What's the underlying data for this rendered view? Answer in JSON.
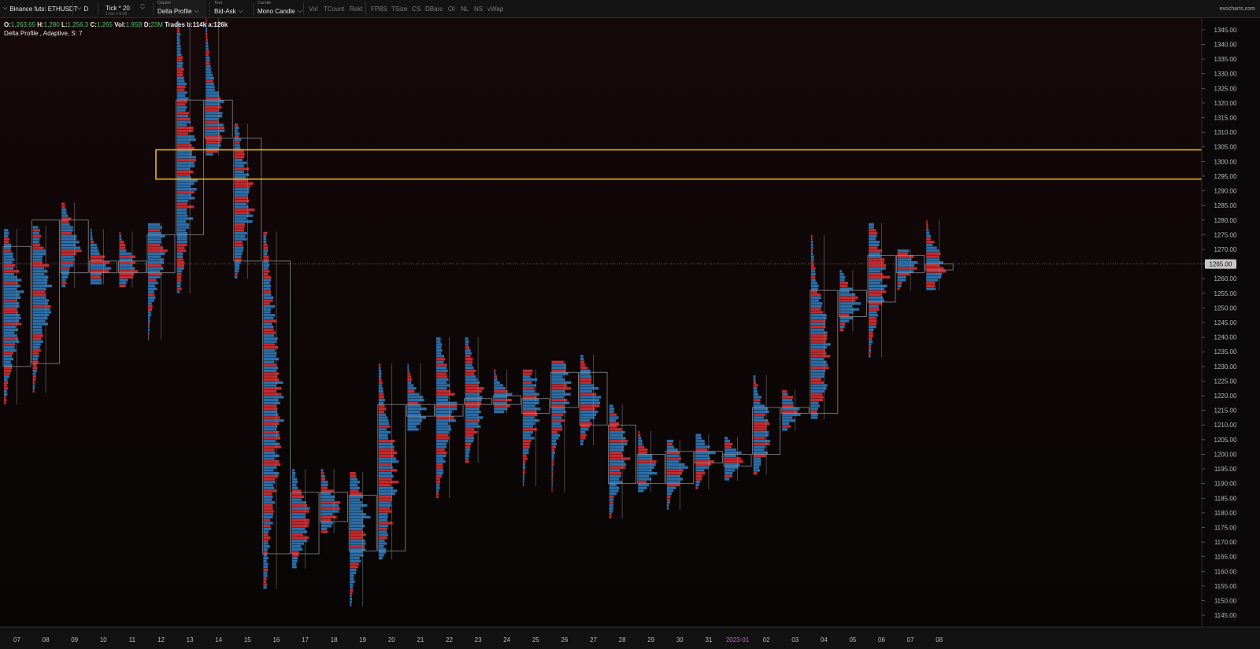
{
  "toolbar": {
    "symbol": "Binance futs: ETHUSDT",
    "timeframe": "D",
    "tick_label": "Tick * 20",
    "tick_sub": "1 tick = 0.05",
    "cluster_caption": "Cluster",
    "cluster_value": "Delta Profile",
    "text_caption": "Text",
    "text_value": "Bid-Ask",
    "candle_caption": "Candle",
    "candle_value": "Mono Candle",
    "toggles": [
      "Vol",
      "TCount",
      "Rekt",
      "FPBS",
      "TSize",
      "CS",
      "DBars",
      "OI",
      "NL",
      "NS",
      "vWap"
    ],
    "brand": "exocharts.com"
  },
  "info": {
    "o_label": "O:",
    "o": "1,263.65",
    "h_label": "H:",
    "h": "1,280",
    "l_label": "L:",
    "l": "1,256.3",
    "c_label": "C:",
    "c": "1,265",
    "vol_label": "Vol:",
    "vol": "1.95B",
    "d_label": "D:",
    "d": "23M",
    "trades_label": "Trades",
    "trades": "b:114k a:126k",
    "indicator": "Delta Profile , Adaptive, S: 7"
  },
  "colors": {
    "bid": "#c42a2e",
    "ask": "#2b6ea8",
    "highlight": "#e8b81c",
    "box": "#9aa0a6",
    "axis_text": "#b8b8b8",
    "year_label": "#c060c0"
  },
  "chart_data": {
    "type": "delta-profile",
    "ylim": [
      1141,
      1349
    ],
    "y_ticks": [
      1145,
      1150,
      1155,
      1160,
      1165,
      1170,
      1175,
      1180,
      1185,
      1190,
      1195,
      1200,
      1205,
      1210,
      1215,
      1220,
      1225,
      1230,
      1235,
      1240,
      1245,
      1250,
      1255,
      1260,
      1265,
      1270,
      1275,
      1280,
      1285,
      1290,
      1295,
      1300,
      1305,
      1310,
      1315,
      1320,
      1325,
      1330,
      1335,
      1340,
      1345
    ],
    "y_tick_labels": [
      "1145.00",
      "1150.00",
      "1155.00",
      "1160.00",
      "1165.00",
      "1170.00",
      "1175.00",
      "1180.00",
      "1185.00",
      "1190.00",
      "1195.00",
      "1200.00",
      "1205.00",
      "1210.00",
      "1215.00",
      "1220.00",
      "1225.00",
      "1230.00",
      "1235.00",
      "1240.00",
      "1245.00",
      "1250.00",
      "1255.00",
      "1260.00",
      "1265.00",
      "1270.00",
      "1275.00",
      "1280.00",
      "1285.00",
      "1290.00",
      "1295.00",
      "1300.00",
      "1305.00",
      "1310.00",
      "1315.00",
      "1320.00",
      "1325.00",
      "1330.00",
      "1335.00",
      "1340.00",
      "1345.00"
    ],
    "current_price": 1265,
    "current_price_label": "1265.00",
    "highlight_zone": [
      1294,
      1304
    ],
    "x_labels": [
      "07",
      "08",
      "09",
      "10",
      "11",
      "12",
      "13",
      "14",
      "15",
      "16",
      "17",
      "18",
      "19",
      "20",
      "21",
      "22",
      "23",
      "24",
      "25",
      "26",
      "27",
      "28",
      "29",
      "30",
      "31",
      "2023-01",
      "02",
      "03",
      "04",
      "05",
      "06",
      "07",
      "08"
    ],
    "year_label_index": 25,
    "bars": [
      {
        "low": 1217,
        "high": 1277,
        "body": [
          1230,
          1271
        ]
      },
      {
        "low": 1221,
        "high": 1278,
        "body": [
          1231,
          1280
        ]
      },
      {
        "low": 1257,
        "high": 1286,
        "body": [
          1262,
          1280
        ]
      },
      {
        "low": 1258,
        "high": 1277,
        "body": [
          1262,
          1266
        ]
      },
      {
        "low": 1257,
        "high": 1276,
        "body": [
          1262,
          1266
        ]
      },
      {
        "low": 1239,
        "high": 1279,
        "body": [
          1262,
          1275
        ]
      },
      {
        "low": 1255,
        "high": 1348,
        "body": [
          1275,
          1321
        ]
      },
      {
        "low": 1302,
        "high": 1349,
        "body": [
          1308,
          1321
        ]
      },
      {
        "low": 1260,
        "high": 1313,
        "body": [
          1266,
          1308
        ]
      },
      {
        "low": 1154,
        "high": 1276,
        "body": [
          1166,
          1266
        ]
      },
      {
        "low": 1161,
        "high": 1195,
        "body": [
          1166,
          1187
        ]
      },
      {
        "low": 1173,
        "high": 1195,
        "body": [
          1177,
          1187
        ]
      },
      {
        "low": 1148,
        "high": 1194,
        "body": [
          1167,
          1186
        ]
      },
      {
        "low": 1164,
        "high": 1231,
        "body": [
          1167,
          1217
        ]
      },
      {
        "low": 1208,
        "high": 1231,
        "body": [
          1213,
          1217
        ]
      },
      {
        "low": 1185,
        "high": 1240,
        "body": [
          1213,
          1217
        ]
      },
      {
        "low": 1197,
        "high": 1240,
        "body": [
          1217,
          1219
        ]
      },
      {
        "low": 1214,
        "high": 1229,
        "body": [
          1217,
          1220
        ]
      },
      {
        "low": 1189,
        "high": 1229,
        "body": [
          1214,
          1219
        ]
      },
      {
        "low": 1187,
        "high": 1232,
        "body": [
          1216,
          1228
        ]
      },
      {
        "low": 1203,
        "high": 1234,
        "body": [
          1210,
          1228
        ]
      },
      {
        "low": 1178,
        "high": 1217,
        "body": [
          1190,
          1210
        ]
      },
      {
        "low": 1187,
        "high": 1208,
        "body": [
          1190,
          1200
        ]
      },
      {
        "low": 1181,
        "high": 1205,
        "body": [
          1190,
          1201
        ]
      },
      {
        "low": 1188,
        "high": 1207,
        "body": [
          1197,
          1201
        ]
      },
      {
        "low": 1191,
        "high": 1206,
        "body": [
          1196,
          1200
        ]
      },
      {
        "low": 1193,
        "high": 1227,
        "body": [
          1200,
          1216
        ]
      },
      {
        "low": 1208,
        "high": 1222,
        "body": [
          1214,
          1216
        ]
      },
      {
        "low": 1212,
        "high": 1275,
        "body": [
          1214,
          1256
        ]
      },
      {
        "low": 1242,
        "high": 1263,
        "body": [
          1247,
          1256
        ]
      },
      {
        "low": 1233,
        "high": 1279,
        "body": [
          1252,
          1268
        ]
      },
      {
        "low": 1256,
        "high": 1270,
        "body": [
          1262,
          1268
        ]
      },
      {
        "low": 1256,
        "high": 1280,
        "body": [
          1263,
          1265
        ]
      }
    ]
  }
}
